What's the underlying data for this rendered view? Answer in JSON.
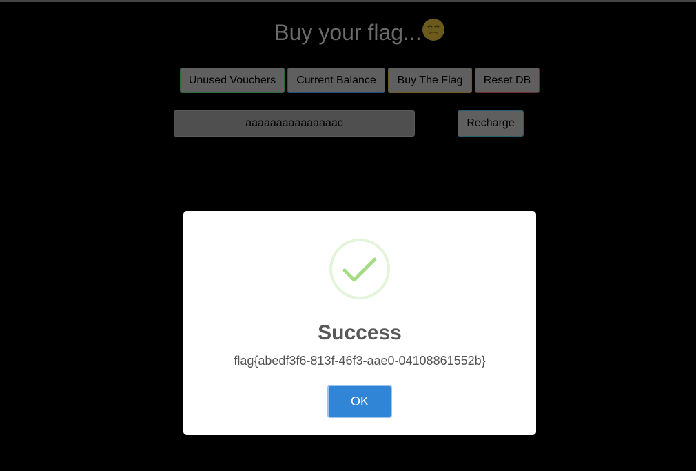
{
  "header": {
    "title": "Buy your flag...",
    "title_emoji_icon": "hand-over-mouth-emoji-icon"
  },
  "actions": {
    "unused_vouchers_label": "Unused Vouchers",
    "current_balance_label": "Current Balance",
    "buy_flag_label": "Buy The Flag",
    "reset_db_label": "Reset DB"
  },
  "recharge": {
    "voucher_value": "aaaaaaaaaaaaaaac",
    "button_label": "Recharge"
  },
  "dialog": {
    "icon": "success-check-icon",
    "title": "Success",
    "message": "flag{abedf3f6-813f-46f3-aae0-04108861552b}",
    "ok_label": "OK",
    "accent_color": "#3085d6",
    "icon_color": "#a5dc86"
  }
}
